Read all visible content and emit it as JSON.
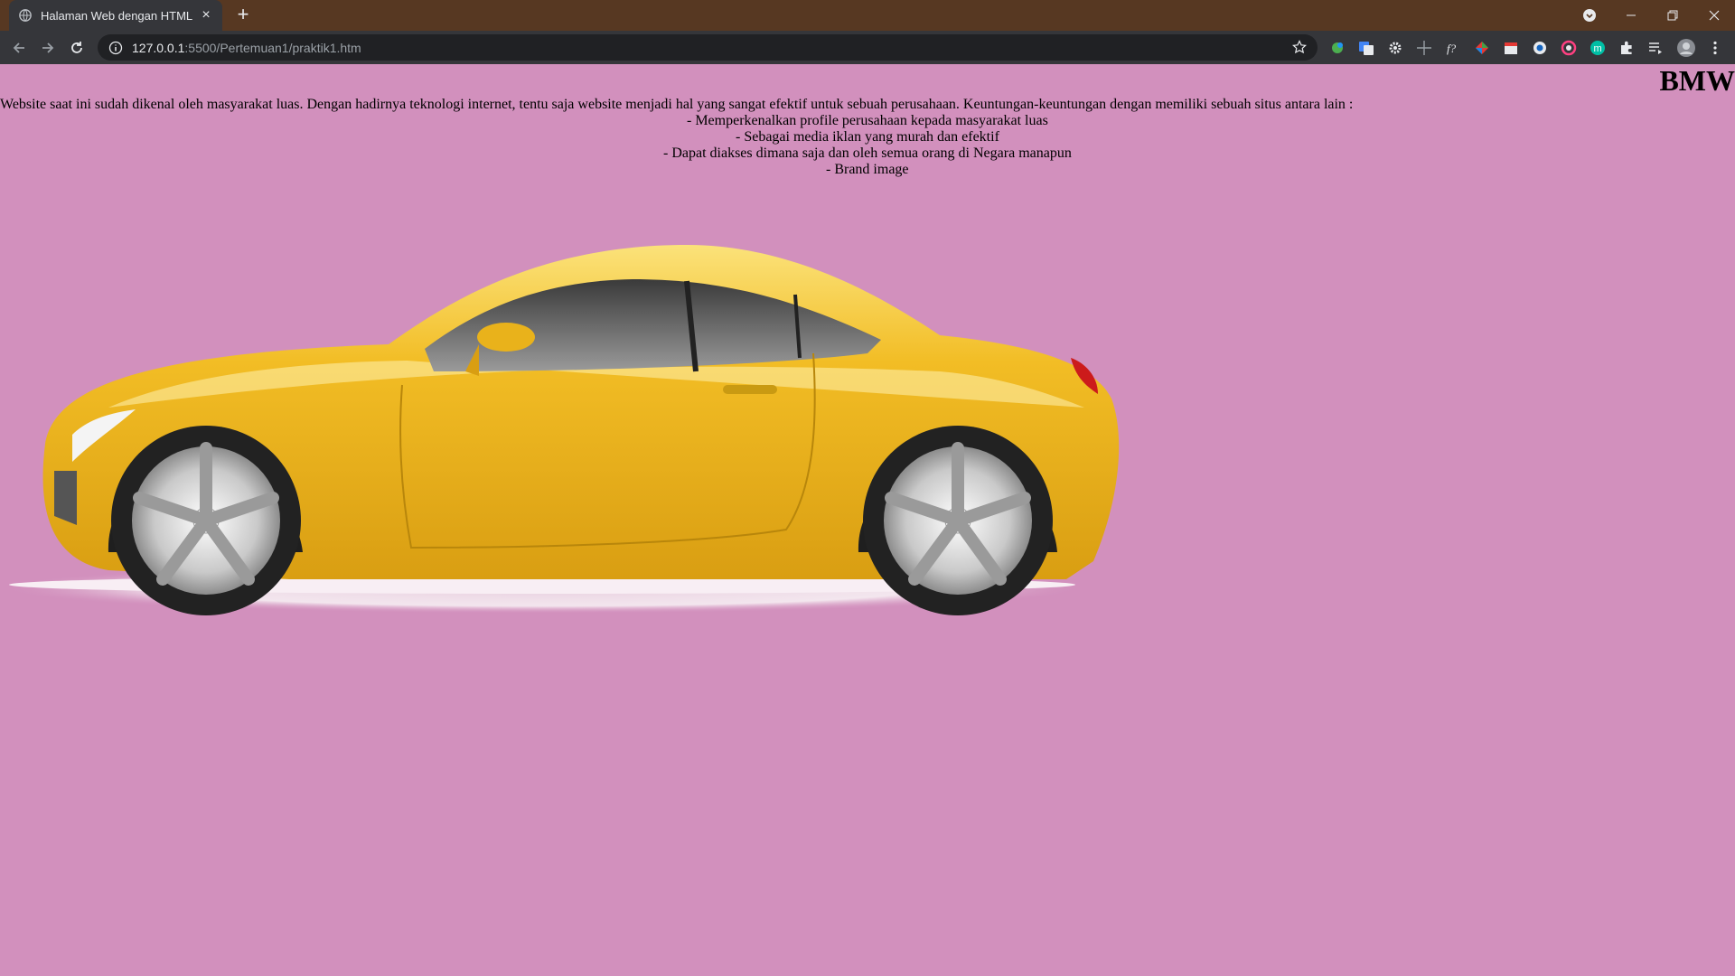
{
  "browser": {
    "tab_title": "Halaman Web dengan HTML",
    "url_host": "127.0.0.1",
    "url_path": ":5500/Pertemuan1/praktik1.htm",
    "tab_close_glyph": "×",
    "new_tab_glyph": "+"
  },
  "page": {
    "heading": "BMW",
    "intro": "Website saat ini sudah dikenal oleh masyarakat luas. Dengan hadirnya teknologi internet, tentu saja website menjadi hal yang sangat efektif untuk sebuah perusahaan. Keuntungan-keuntungan dengan memiliki sebuah situs antara lain :",
    "items": [
      "- Memperkenalkan profile perusahaan kepada masyarakat luas",
      "- Sebagai media iklan yang murah dan efektif",
      "- Dapat diakses dimana saja dan oleh semua orang di Negara manapun",
      "- Brand image"
    ]
  },
  "colors": {
    "tabbar": "#573822",
    "toolbar": "#35363a",
    "page_background": "#d290bd",
    "car_body": "#f2bd25"
  },
  "icons": [
    "globe-icon",
    "close-icon",
    "plus-icon",
    "back-icon",
    "forward-icon",
    "reload-icon",
    "info-icon",
    "star-icon",
    "extensions-icon",
    "menu-icon",
    "profile-icon"
  ]
}
